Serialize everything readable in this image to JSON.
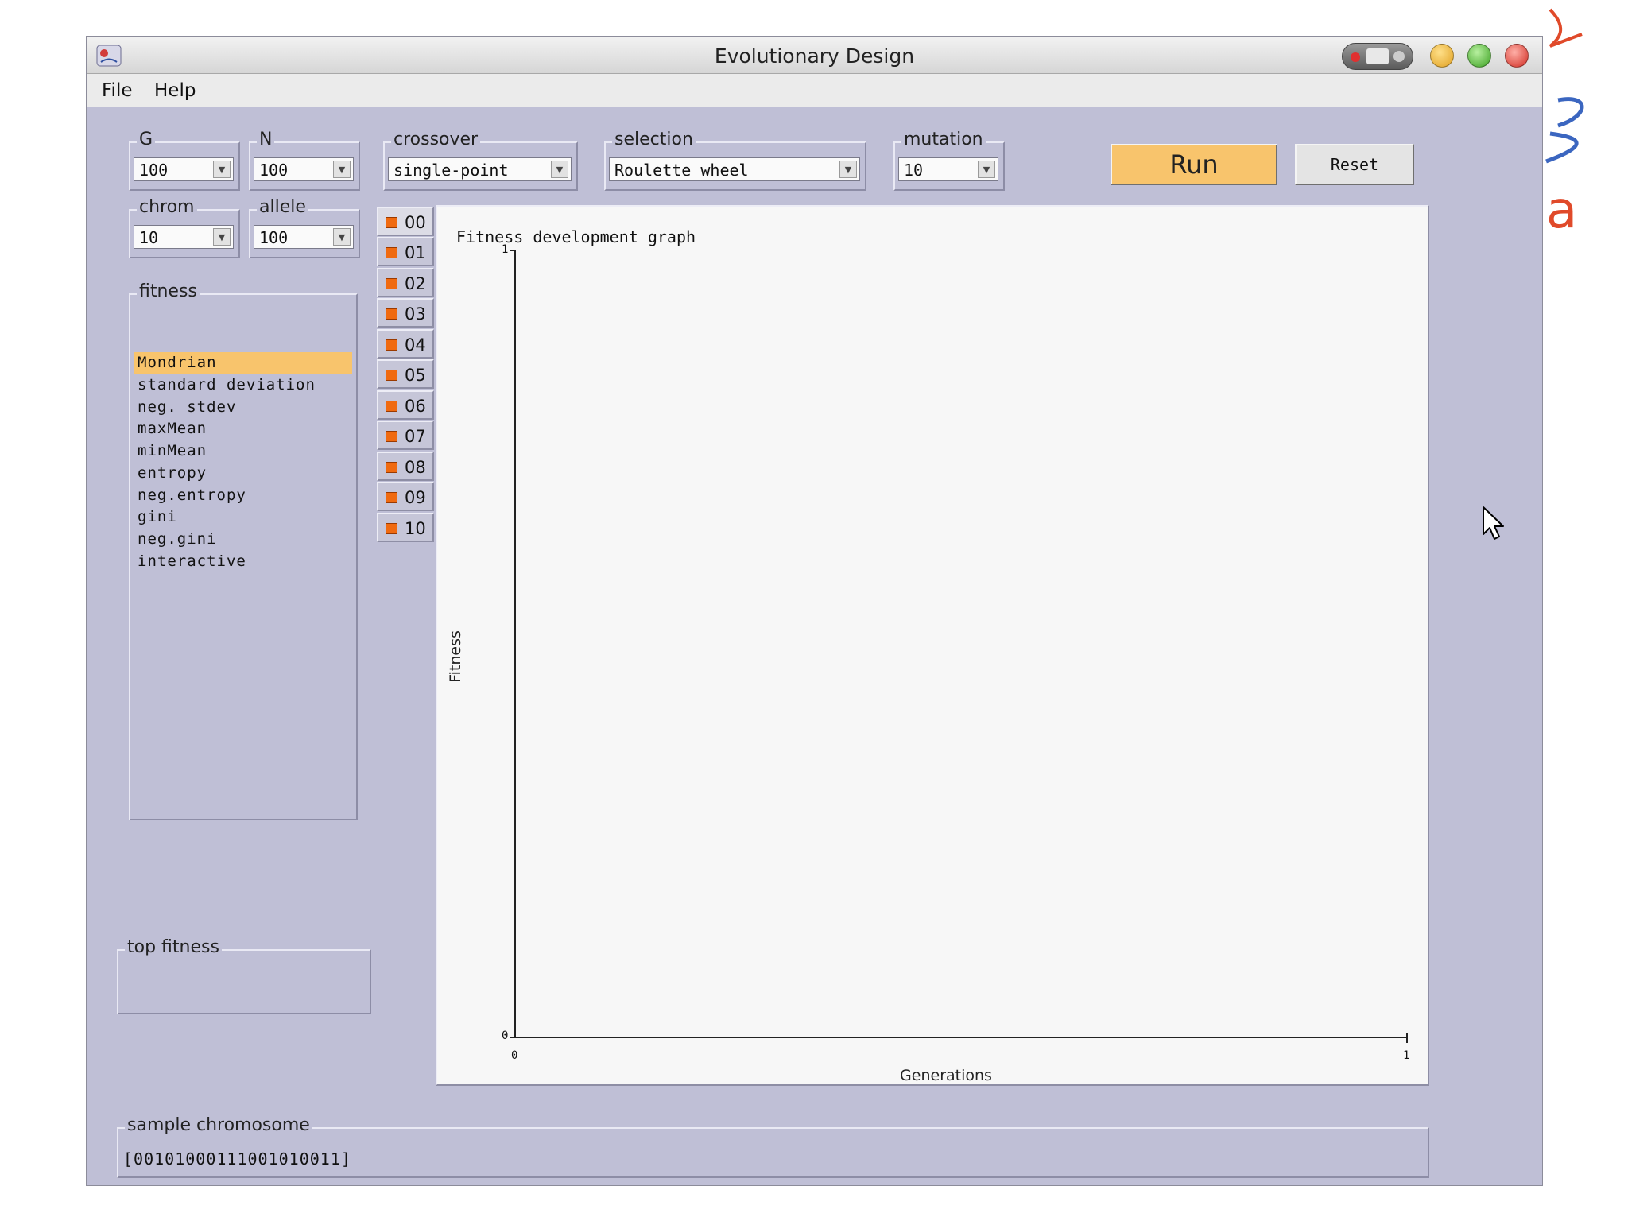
{
  "window": {
    "title": "Evolutionary Design"
  },
  "menu": {
    "items": [
      "File",
      "Help"
    ]
  },
  "params": {
    "g": {
      "label": "G",
      "value": "100"
    },
    "n": {
      "label": "N",
      "value": "100"
    },
    "crossover": {
      "label": "crossover",
      "value": "single-point"
    },
    "selection": {
      "label": "selection",
      "value": "Roulette wheel"
    },
    "mutation": {
      "label": "mutation",
      "value": "10"
    },
    "chrom": {
      "label": "chrom",
      "value": "10"
    },
    "allele": {
      "label": "allele",
      "value": "100"
    }
  },
  "buttons": {
    "run": "Run",
    "reset": "Reset"
  },
  "fitness": {
    "label": "fitness",
    "selected": "Mondrian",
    "items": [
      "Mondrian",
      "standard deviation",
      "neg. stdev",
      "maxMean",
      "minMean",
      "entropy",
      "neg.entropy",
      "gini",
      "neg.gini",
      "interactive"
    ]
  },
  "tabs": [
    "00",
    "01",
    "02",
    "03",
    "04",
    "05",
    "06",
    "07",
    "08",
    "09",
    "10"
  ],
  "graph": {
    "title": "Fitness development graph",
    "ylabel": "Fitness",
    "xlabel": "Generations",
    "y_ticks": [
      "1",
      "0"
    ],
    "x_ticks": [
      "0",
      "1"
    ]
  },
  "top_fitness": {
    "label": "top fitness",
    "value": ""
  },
  "sample_chromosome": {
    "label": "sample chromosome",
    "value": "[00101000111001010011]"
  },
  "colors": {
    "window_bg": "#bfbfd6",
    "selection_highlight": "#f8c46c",
    "run_button": "#f8c46c",
    "tab_marker": "#f06a10",
    "graph_bg": "#f7f7f7"
  },
  "icons": {
    "app": "java-app-icon",
    "cursor": "mouse-pointer-icon"
  }
}
